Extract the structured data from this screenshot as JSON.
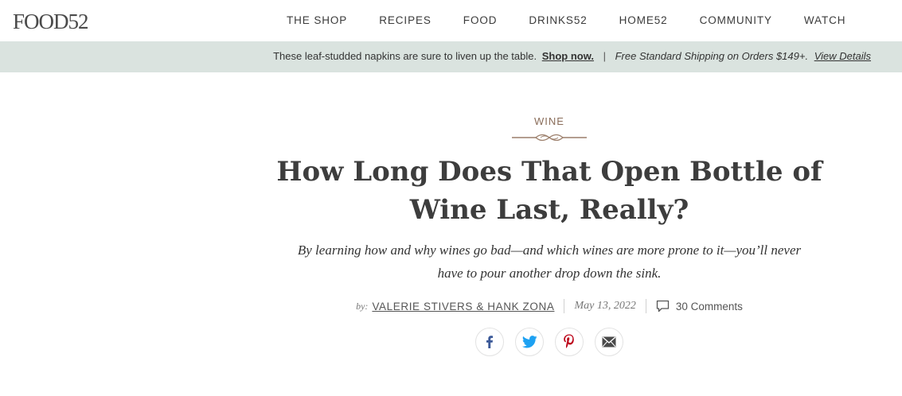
{
  "header": {
    "logo": "FOOD52",
    "nav": [
      "THE SHOP",
      "RECIPES",
      "FOOD",
      "DRINKS52",
      "HOME52",
      "COMMUNITY",
      "WATCH"
    ]
  },
  "promo": {
    "message": "These leaf-studded napkins are sure to liven up the table.",
    "cta": "Shop now.",
    "separator": "|",
    "shipping": "Free Standard Shipping on Orders $149+.",
    "details": "View Details"
  },
  "article": {
    "category": "WINE",
    "title_line1": "How Long Does That Open Bottle of",
    "title_line2": "Wine Last, Really?",
    "subtitle": "By learning how and why wines go bad—and which wines are more prone to it—you’ll never have to pour another drop down the sink.",
    "by_prefix": "by:",
    "authors": "VALERIE STIVERS & HANK ZONA",
    "date": "May 13, 2022",
    "comments": "30 Comments"
  },
  "share": {
    "icons": [
      "facebook-icon",
      "twitter-icon",
      "pinterest-icon",
      "email-icon"
    ]
  },
  "colors": {
    "promo_bg": "#dae3df",
    "category": "#8a6d5a",
    "facebook": "#3b5998",
    "twitter": "#1da1f2",
    "pinterest": "#bd081c",
    "email": "#4a4a4a"
  }
}
